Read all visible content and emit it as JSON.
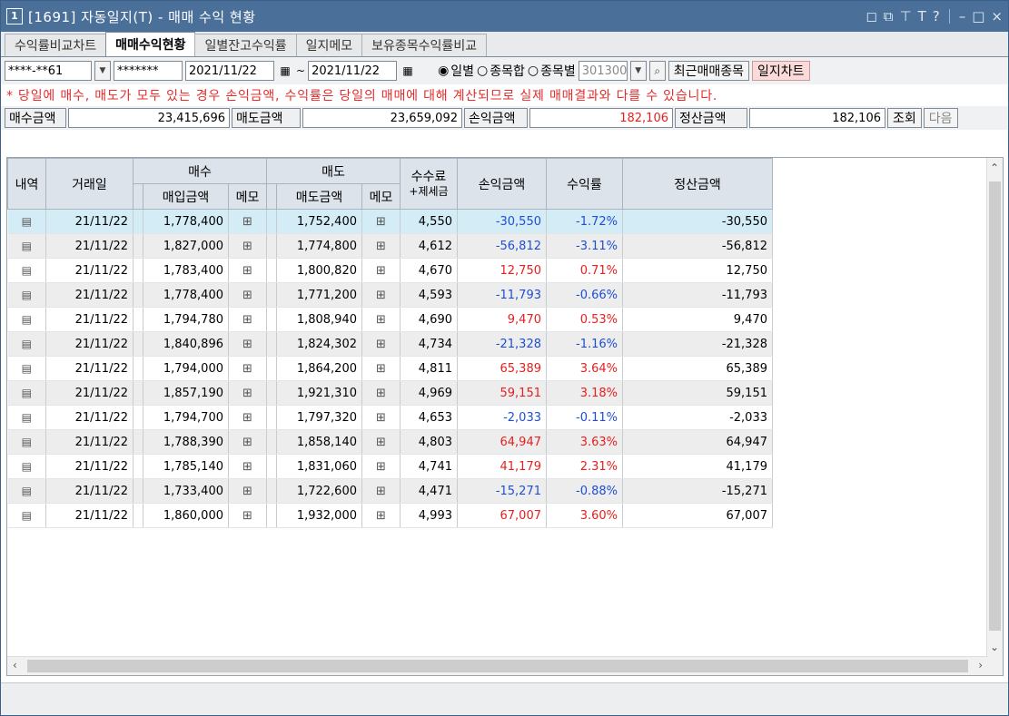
{
  "window": {
    "number": "1",
    "title": "[1691] 자동일지(T) - 매매 수익 현황"
  },
  "tabs": [
    "수익률비교차트",
    "매매수익현황",
    "일별잔고수익률",
    "일지메모",
    "보유종목수익률비교"
  ],
  "controls": {
    "account": "****-**61",
    "password": "*******",
    "date_from": "2021/11/22",
    "tilde": "~",
    "date_to": "2021/11/22",
    "radio_daily": "일별",
    "radio_sum": "종목합",
    "radio_each": "종목별",
    "stock_code": "301300",
    "recent_button": "최근매매종목",
    "chart_button": "일지차트"
  },
  "notice": "* 당일에 매수, 매도가 모두 있는 경우 손익금액, 수익률은 당일의 매매에 대해 계산되므로 실제 매매결과와 다를 수 있습니다.",
  "summary": {
    "buy_label": "매수금액",
    "buy_value": "23,415,696",
    "sell_label": "매도금액",
    "sell_value": "23,659,092",
    "pl_label": "손익금액",
    "pl_value": "182,106",
    "settle_label": "정산금액",
    "settle_value": "182,106",
    "query_button": "조회",
    "next_button": "다음"
  },
  "grid": {
    "headers": {
      "detail": "내역",
      "date": "거래일",
      "buy": "매수",
      "buy_amount": "매입금액",
      "memo1": "메모",
      "sell": "매도",
      "sell_amount": "매도금액",
      "memo2": "메모",
      "fee": "수수료",
      "fee2": "+제세금",
      "pl": "손익금액",
      "rate": "수익률",
      "settle": "정산금액"
    },
    "rows": [
      {
        "date": "21/11/22",
        "buy": "1,778,400",
        "sell": "1,752,400",
        "fee": "4,550",
        "pl": "-30,550",
        "rate": "-1.72%",
        "settle": "-30,550",
        "sign": "neg"
      },
      {
        "date": "21/11/22",
        "buy": "1,827,000",
        "sell": "1,774,800",
        "fee": "4,612",
        "pl": "-56,812",
        "rate": "-3.11%",
        "settle": "-56,812",
        "sign": "neg"
      },
      {
        "date": "21/11/22",
        "buy": "1,783,400",
        "sell": "1,800,820",
        "fee": "4,670",
        "pl": "12,750",
        "rate": "0.71%",
        "settle": "12,750",
        "sign": "pos"
      },
      {
        "date": "21/11/22",
        "buy": "1,778,400",
        "sell": "1,771,200",
        "fee": "4,593",
        "pl": "-11,793",
        "rate": "-0.66%",
        "settle": "-11,793",
        "sign": "neg"
      },
      {
        "date": "21/11/22",
        "buy": "1,794,780",
        "sell": "1,808,940",
        "fee": "4,690",
        "pl": "9,470",
        "rate": "0.53%",
        "settle": "9,470",
        "sign": "pos"
      },
      {
        "date": "21/11/22",
        "buy": "1,840,896",
        "sell": "1,824,302",
        "fee": "4,734",
        "pl": "-21,328",
        "rate": "-1.16%",
        "settle": "-21,328",
        "sign": "neg"
      },
      {
        "date": "21/11/22",
        "buy": "1,794,000",
        "sell": "1,864,200",
        "fee": "4,811",
        "pl": "65,389",
        "rate": "3.64%",
        "settle": "65,389",
        "sign": "pos"
      },
      {
        "date": "21/11/22",
        "buy": "1,857,190",
        "sell": "1,921,310",
        "fee": "4,969",
        "pl": "59,151",
        "rate": "3.18%",
        "settle": "59,151",
        "sign": "pos"
      },
      {
        "date": "21/11/22",
        "buy": "1,794,700",
        "sell": "1,797,320",
        "fee": "4,653",
        "pl": "-2,033",
        "rate": "-0.11%",
        "settle": "-2,033",
        "sign": "neg"
      },
      {
        "date": "21/11/22",
        "buy": "1,788,390",
        "sell": "1,858,140",
        "fee": "4,803",
        "pl": "64,947",
        "rate": "3.63%",
        "settle": "64,947",
        "sign": "pos"
      },
      {
        "date": "21/11/22",
        "buy": "1,785,140",
        "sell": "1,831,060",
        "fee": "4,741",
        "pl": "41,179",
        "rate": "2.31%",
        "settle": "41,179",
        "sign": "pos"
      },
      {
        "date": "21/11/22",
        "buy": "1,733,400",
        "sell": "1,722,600",
        "fee": "4,471",
        "pl": "-15,271",
        "rate": "-0.88%",
        "settle": "-15,271",
        "sign": "neg"
      },
      {
        "date": "21/11/22",
        "buy": "1,860,000",
        "sell": "1,932,000",
        "fee": "4,993",
        "pl": "67,007",
        "rate": "3.60%",
        "settle": "67,007",
        "sign": "pos"
      }
    ]
  },
  "colors": {
    "negative": "#1f4fd1",
    "positive": "#e52020",
    "titlebar": "#4a6f99",
    "selected_row": "#d4ecf6"
  }
}
